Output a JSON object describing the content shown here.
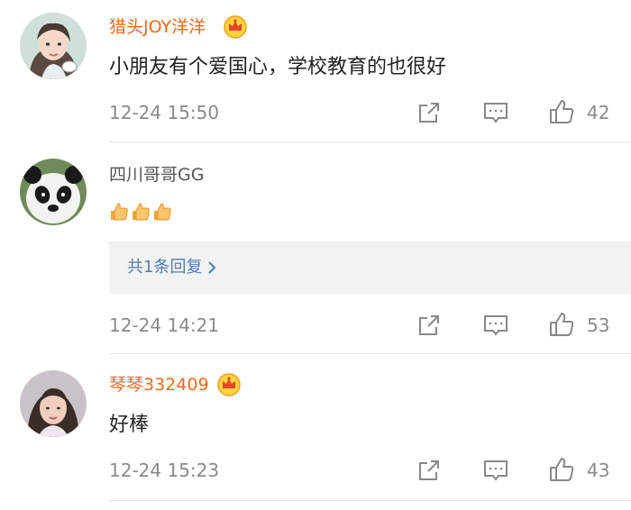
{
  "comments": [
    {
      "username": "猎头JOY洋洋",
      "text": "小朋友有个爱国心，学校教育的也很好",
      "time": "12-24 15:50",
      "likes": "42",
      "vip": true
    },
    {
      "username": "四川哥哥GG",
      "emoji": "👍👍👍",
      "reply_label": "共1条回复",
      "time": "12-24 14:21",
      "likes": "53",
      "vip": false
    },
    {
      "username": "琴琴332409",
      "text": "好棒",
      "time": "12-24 15:23",
      "likes": "43",
      "vip": true
    }
  ],
  "colors": {
    "vip_name": "#f26a1b",
    "normal_name": "#555555",
    "reply_link": "#507daf",
    "meta": "#8a8a8a"
  }
}
